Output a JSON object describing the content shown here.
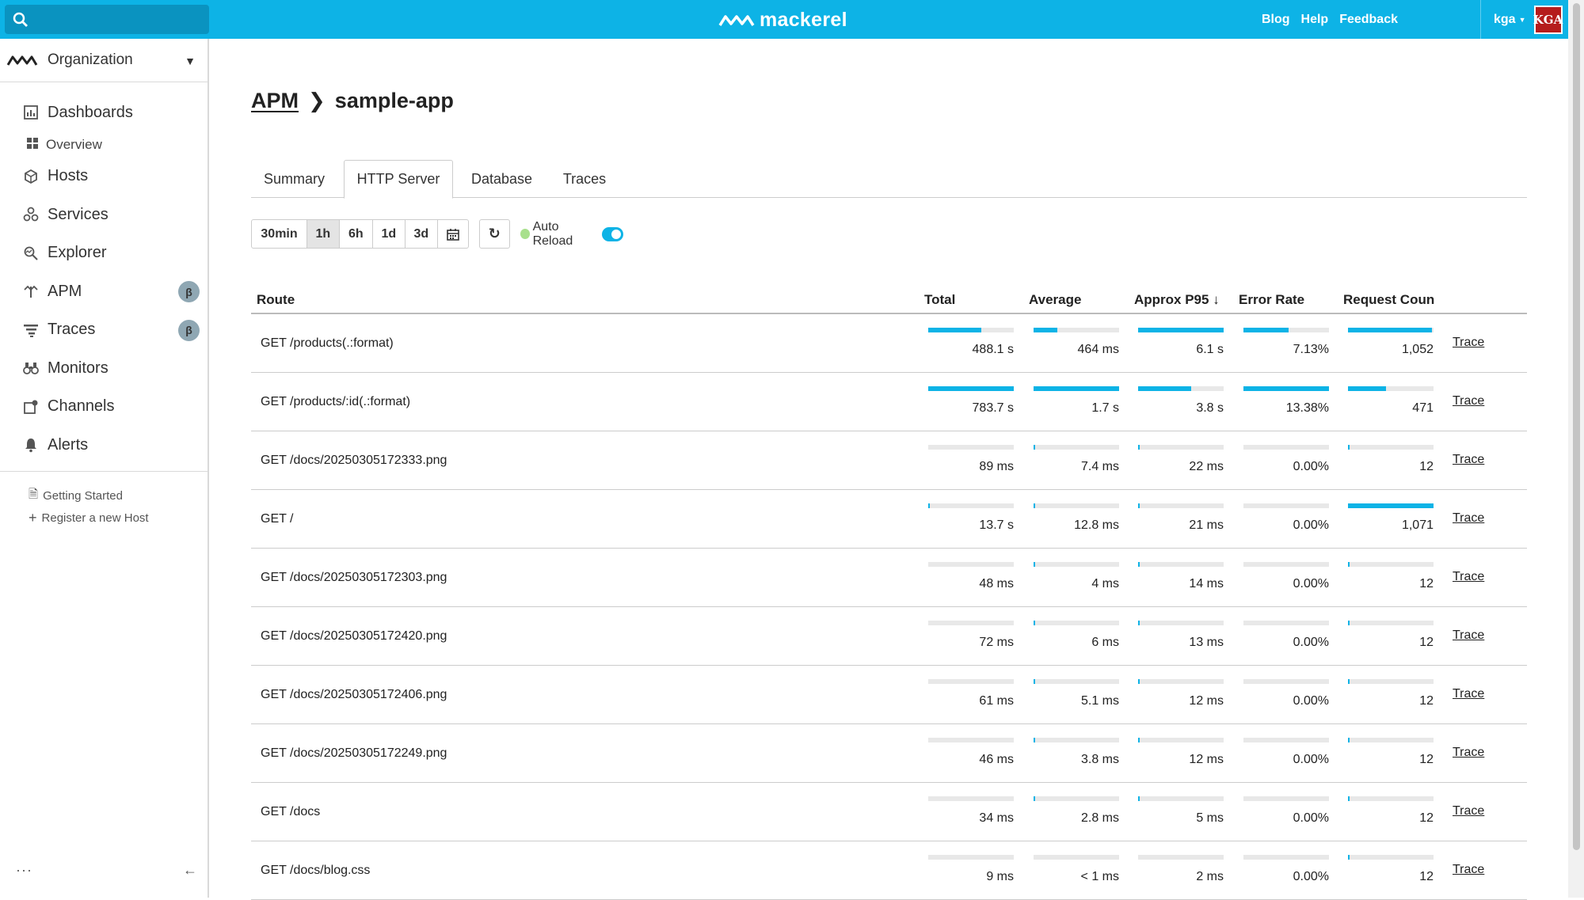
{
  "header": {
    "logo_text": "mackerel",
    "links": [
      "Blog",
      "Help",
      "Feedback"
    ],
    "user": "kga",
    "avatar_text": "KGA",
    "accent": "#0db3e6"
  },
  "sidebar": {
    "org": "Organization",
    "items": [
      {
        "label": "Dashboards",
        "icon": "dashboard-icon"
      },
      {
        "label": "Overview",
        "icon": "grid-icon",
        "sub": true
      },
      {
        "label": "Hosts",
        "icon": "cube-icon"
      },
      {
        "label": "Services",
        "icon": "services-icon"
      },
      {
        "label": "Explorer",
        "icon": "explorer-icon"
      },
      {
        "label": "APM",
        "icon": "apm-icon",
        "beta": "β"
      },
      {
        "label": "Traces",
        "icon": "traces-icon",
        "beta": "β"
      },
      {
        "label": "Monitors",
        "icon": "binoculars-icon"
      },
      {
        "label": "Channels",
        "icon": "channels-icon"
      },
      {
        "label": "Alerts",
        "icon": "bell-icon"
      }
    ],
    "extra": [
      {
        "label": "Getting Started",
        "icon": "document-icon"
      },
      {
        "label": "Register a new Host",
        "icon": "plus-icon"
      }
    ],
    "more": "···",
    "collapse": "←"
  },
  "breadcrumb": {
    "parent": "APM",
    "current": "sample-app"
  },
  "tabs": [
    "Summary",
    "HTTP Server",
    "Database",
    "Traces"
  ],
  "active_tab": "HTTP Server",
  "toolbar": {
    "ranges": [
      "30min",
      "1h",
      "6h",
      "1d",
      "3d"
    ],
    "active_range": "1h",
    "auto_reload_label": "Auto Reload",
    "auto_reload_on": true
  },
  "table": {
    "columns": [
      "Route",
      "Total",
      "Average",
      "Approx P95 ↓",
      "Error Rate",
      "Request Coun"
    ],
    "trace_label": "Trace",
    "rows": [
      {
        "route": "GET /products(.:format)",
        "total": "488.1 s",
        "average": "464 ms",
        "p95": "6.1 s",
        "error": "7.13%",
        "count": "1,052",
        "bars": [
          0.62,
          0.28,
          1.0,
          0.53,
          0.98
        ]
      },
      {
        "route": "GET /products/:id(.:format)",
        "total": "783.7 s",
        "average": "1.7 s",
        "p95": "3.8 s",
        "error": "13.38%",
        "count": "471",
        "bars": [
          1.0,
          1.0,
          0.62,
          1.0,
          0.44
        ]
      },
      {
        "route": "GET /docs/20250305172333.png",
        "total": "89 ms",
        "average": "7.4 ms",
        "p95": "22 ms",
        "error": "0.00%",
        "count": "12",
        "bars": [
          0,
          0.004,
          0.004,
          0,
          0.011
        ]
      },
      {
        "route": "GET /",
        "total": "13.7 s",
        "average": "12.8 ms",
        "p95": "21 ms",
        "error": "0.00%",
        "count": "1,071",
        "bars": [
          0.017,
          0.007,
          0.004,
          0,
          1.0
        ]
      },
      {
        "route": "GET /docs/20250305172303.png",
        "total": "48 ms",
        "average": "4 ms",
        "p95": "14 ms",
        "error": "0.00%",
        "count": "12",
        "bars": [
          0,
          0.002,
          0.002,
          0,
          0.011
        ]
      },
      {
        "route": "GET /docs/20250305172420.png",
        "total": "72 ms",
        "average": "6 ms",
        "p95": "13 ms",
        "error": "0.00%",
        "count": "12",
        "bars": [
          0,
          0.004,
          0.002,
          0,
          0.011
        ]
      },
      {
        "route": "GET /docs/20250305172406.png",
        "total": "61 ms",
        "average": "5.1 ms",
        "p95": "12 ms",
        "error": "0.00%",
        "count": "12",
        "bars": [
          0,
          0.003,
          0.002,
          0,
          0.011
        ]
      },
      {
        "route": "GET /docs/20250305172249.png",
        "total": "46 ms",
        "average": "3.8 ms",
        "p95": "12 ms",
        "error": "0.00%",
        "count": "12",
        "bars": [
          0,
          0.002,
          0.002,
          0,
          0.011
        ]
      },
      {
        "route": "GET /docs",
        "total": "34 ms",
        "average": "2.8 ms",
        "p95": "5 ms",
        "error": "0.00%",
        "count": "12",
        "bars": [
          0,
          0.002,
          0.001,
          0,
          0.011
        ]
      },
      {
        "route": "GET /docs/blog.css",
        "total": "9 ms",
        "average": "< 1 ms",
        "p95": "2 ms",
        "error": "0.00%",
        "count": "12",
        "bars": [
          0,
          0.0,
          0.0,
          0,
          0.011
        ]
      }
    ]
  }
}
